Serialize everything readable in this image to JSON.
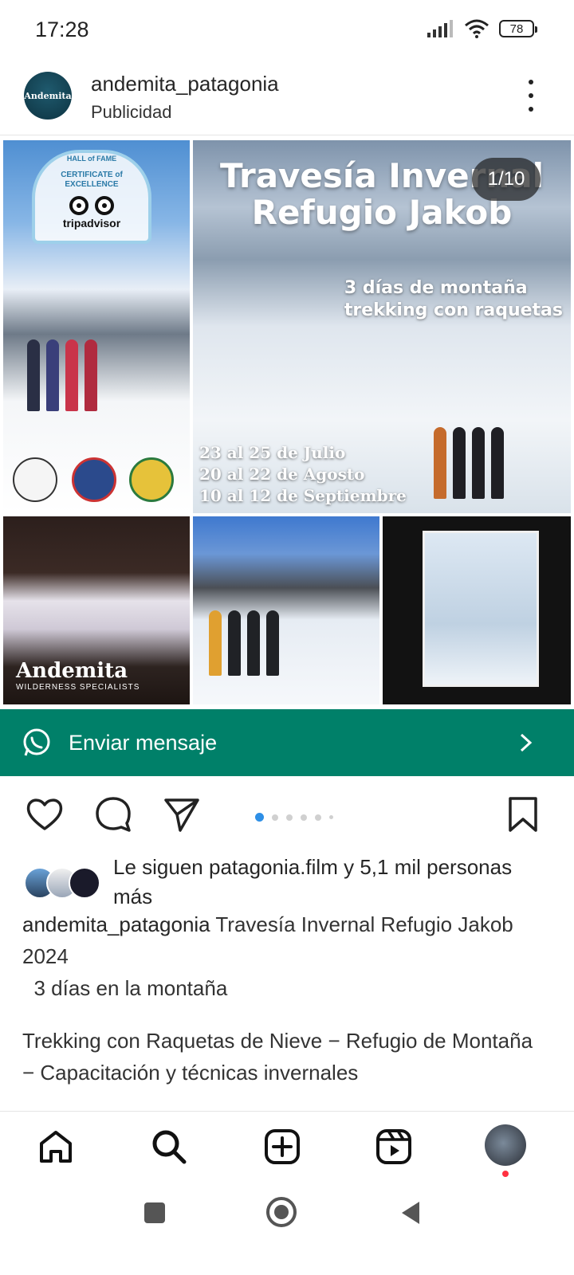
{
  "status_bar": {
    "time": "17:28",
    "battery": "78",
    "icons": [
      "signal-icon",
      "wifi-icon",
      "battery-icon"
    ]
  },
  "post": {
    "username": "andemita_patagonia",
    "subtitle": "Publicidad",
    "avatar_text": "Andemita",
    "media": {
      "counter": "1/10",
      "badge_hall": "HALL of FAME",
      "badge_line1": "CERTIFICATE of",
      "badge_line2": "EXCELLENCE",
      "badge_brand": "tripadvisor",
      "banner_title_line1": "Travesía Invernal",
      "banner_title_line2": "Refugio Jakob",
      "banner_sub_line1": "3 días de montaña",
      "banner_sub_line2": "trekking con raquetas",
      "dates": [
        "23 al 25 de Julio",
        "20 al 22  de Agosto",
        "10 al 12 de Septiembre"
      ],
      "logo_word": "Andemita",
      "logo_tag": "WILDERNESS SPECIALISTS"
    },
    "cta": {
      "label": "Enviar mensaje",
      "accent": "#008069"
    },
    "carousel": {
      "total_dots": 6,
      "active_index": 0
    },
    "followers": {
      "prefix": "Le siguen ",
      "name": "patagonia.film",
      "suffix": " y 5,1 mil personas más"
    },
    "caption": {
      "user": "andemita_patagonia",
      "text": " Travesía Invernal Refugio Jakob 2024",
      "line2": "  3 días en la montaña",
      "line3": "Trekking con Raquetas de Nieve − Refugio de Montaña − Capacitación y técnicas invernales"
    }
  },
  "colors": {
    "accent_blue": "#2e8fe6",
    "notification": "#ff3040",
    "text": "#262626"
  }
}
